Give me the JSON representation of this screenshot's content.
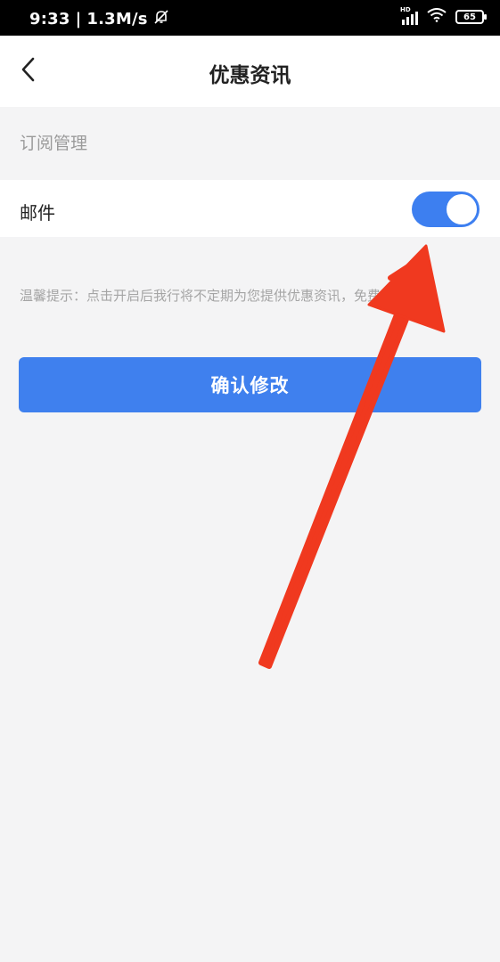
{
  "status_bar": {
    "time": "9:33",
    "separator": "|",
    "speed": "1.3M/s",
    "hd": "HD",
    "battery": "65",
    "icons": [
      "bell-muted-icon",
      "signal-icon",
      "wifi-icon",
      "battery-icon"
    ]
  },
  "nav": {
    "title": "优惠资讯",
    "back_icon": "chevron-left-icon"
  },
  "section": {
    "header": "订阅管理"
  },
  "subscriptions": {
    "mail_label": "邮件",
    "mail_enabled": true
  },
  "tip": {
    "text": "温馨提示：点击开启后我行将不定期为您提供优惠资讯，免费。"
  },
  "actions": {
    "confirm_label": "确认修改"
  },
  "colors": {
    "accent": "#3f80ee",
    "toggle_on": "#3d7ff0",
    "annotation_arrow": "#f0391f",
    "background": "#f4f4f5"
  }
}
